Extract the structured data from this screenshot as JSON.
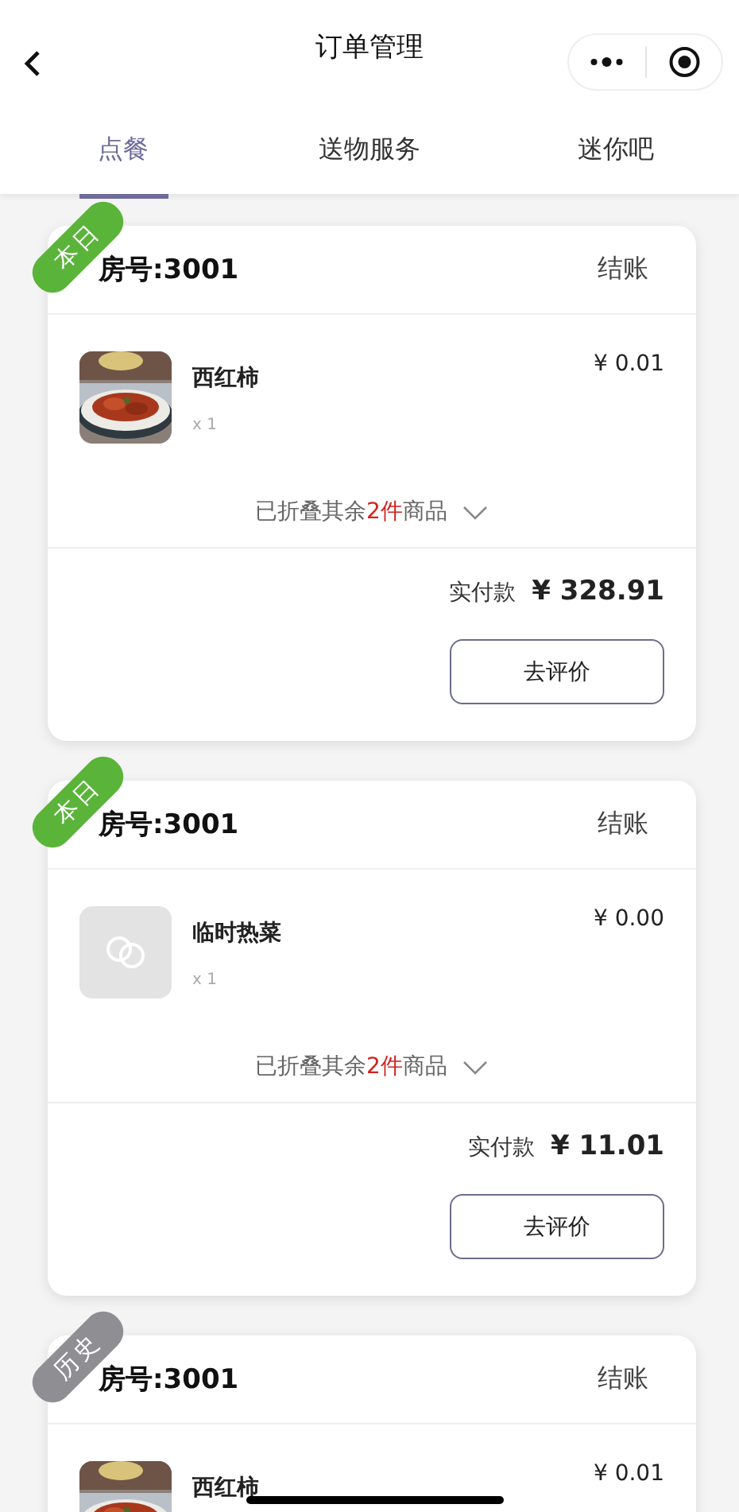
{
  "nav": {
    "title": "订单管理"
  },
  "tabs": [
    {
      "label": "点餐",
      "selected": true
    },
    {
      "label": "送物服务",
      "selected": false
    },
    {
      "label": "迷你吧",
      "selected": false
    }
  ],
  "orders": [
    {
      "tag": {
        "label": "本日",
        "kind": "today"
      },
      "room": "房号:3001",
      "action": "结账",
      "items": [
        {
          "name": "西红柿",
          "qty": "x 1",
          "price": "¥ 0.01",
          "kind": "food"
        }
      ],
      "folded": {
        "before": "已折叠其余",
        "count": "2件",
        "after": "商品"
      },
      "total_label": "实付款",
      "total": "¥ 328.91",
      "button": "去评价"
    },
    {
      "tag": {
        "label": "本日",
        "kind": "today"
      },
      "room": "房号:3001",
      "action": "结账",
      "items": [
        {
          "name": "临时热菜",
          "qty": "x 1",
          "price": "¥ 0.00",
          "kind": "placeholder"
        }
      ],
      "folded": {
        "before": "已折叠其余",
        "count": "2件",
        "after": "商品"
      },
      "total_label": "实付款",
      "total": "¥ 11.01",
      "button": "去评价"
    },
    {
      "tag": {
        "label": "历史",
        "kind": "history"
      },
      "room": "房号:3001",
      "action": "结账",
      "items": [
        {
          "name": "西红柿",
          "price": "¥ 0.01",
          "kind": "food"
        }
      ]
    }
  ]
}
